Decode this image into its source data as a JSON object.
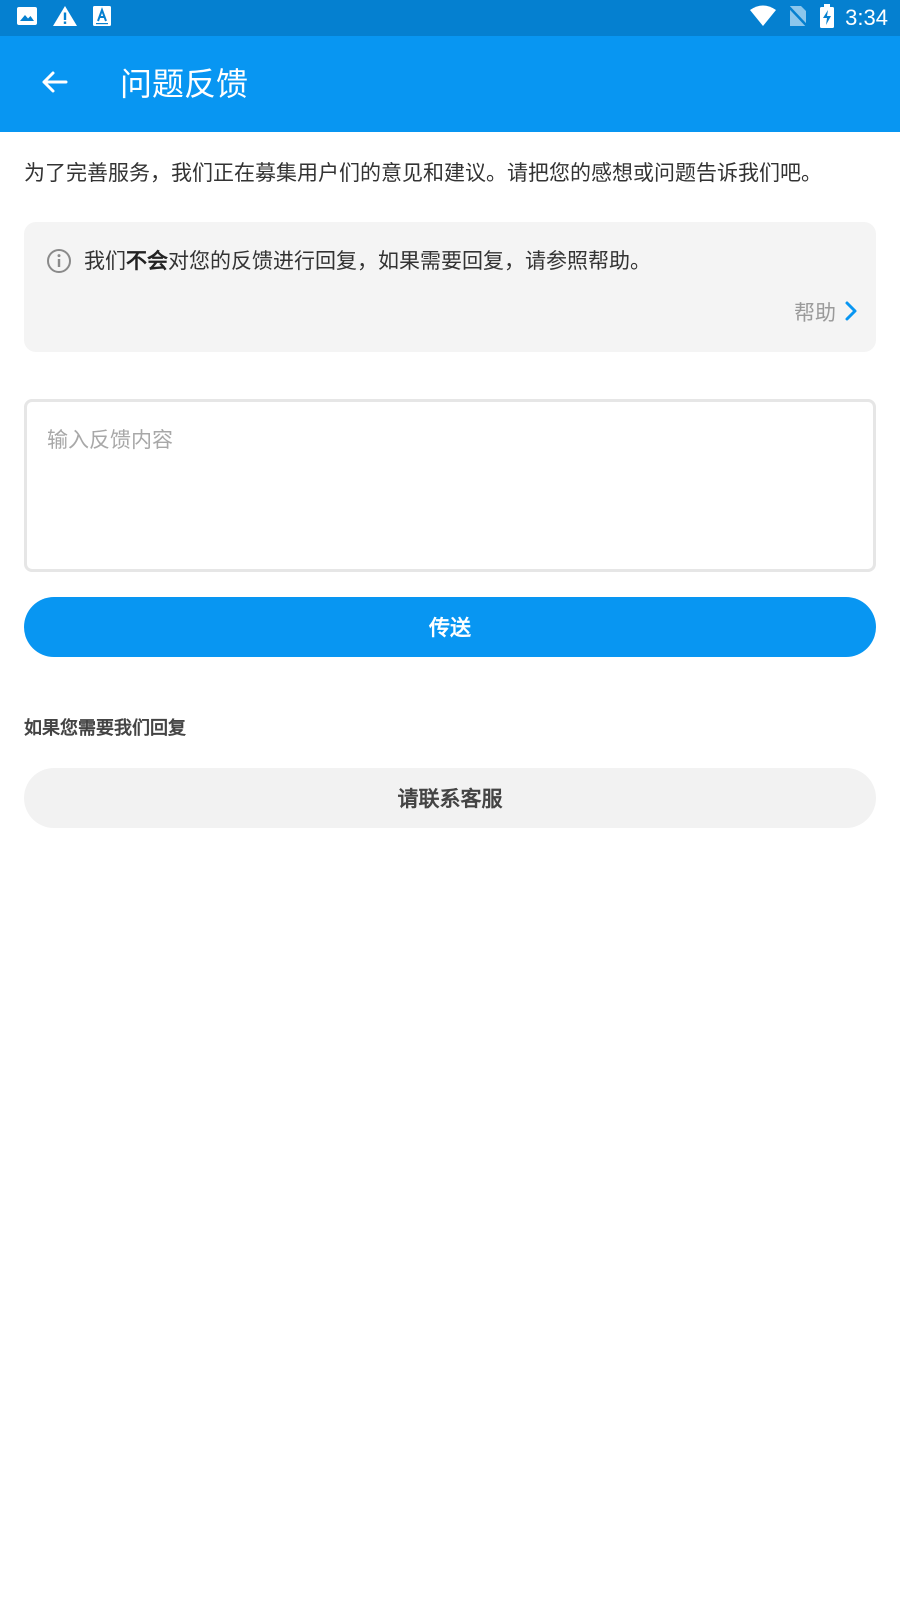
{
  "status_bar": {
    "time": "3:34",
    "left_icons": [
      "image-icon",
      "warning-icon",
      "text-recognition-icon"
    ],
    "right_icons": [
      "wifi-icon",
      "no-sim-icon",
      "battery-charging-icon"
    ]
  },
  "header": {
    "title": "问题反馈",
    "back_icon": "back-arrow-icon"
  },
  "intro": "为了完善服务，我们正在募集用户们的意见和建议。请把您的感想或问题告诉我们吧。",
  "notice": {
    "icon": "info-icon",
    "text_before": "我们",
    "text_bold": "不会",
    "text_after": "对您的反馈进行回复，如果需要回复，请参照帮助。",
    "help_label": "帮助",
    "help_icon": "chevron-right-icon"
  },
  "feedback": {
    "value": "",
    "placeholder": "输入反馈内容"
  },
  "send_label": "传送",
  "reply_heading": "如果您需要我们回复",
  "contact_label": "请联系客服",
  "colors": {
    "status_bar": "#0580d0",
    "app_bar": "#0896f2",
    "accent": "#0896f2",
    "card_bg": "#f4f4f4",
    "secondary_button_bg": "#f2f2f2"
  }
}
